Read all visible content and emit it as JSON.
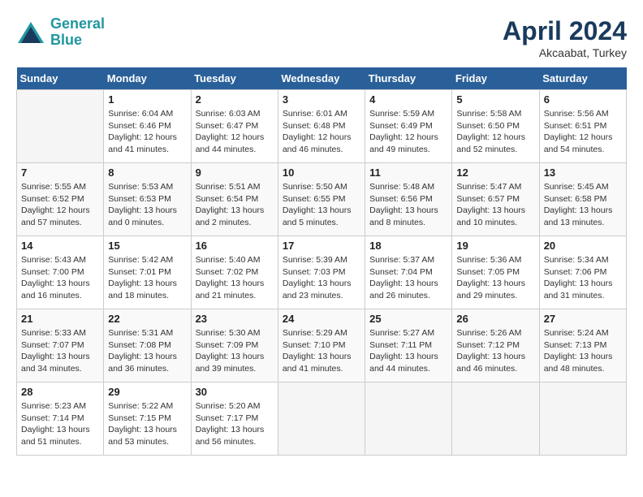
{
  "header": {
    "logo_line1": "General",
    "logo_line2": "Blue",
    "month_year": "April 2024",
    "location": "Akcaabat, Turkey"
  },
  "weekdays": [
    "Sunday",
    "Monday",
    "Tuesday",
    "Wednesday",
    "Thursday",
    "Friday",
    "Saturday"
  ],
  "weeks": [
    [
      {
        "day": "",
        "info": ""
      },
      {
        "day": "1",
        "info": "Sunrise: 6:04 AM\nSunset: 6:46 PM\nDaylight: 12 hours\nand 41 minutes."
      },
      {
        "day": "2",
        "info": "Sunrise: 6:03 AM\nSunset: 6:47 PM\nDaylight: 12 hours\nand 44 minutes."
      },
      {
        "day": "3",
        "info": "Sunrise: 6:01 AM\nSunset: 6:48 PM\nDaylight: 12 hours\nand 46 minutes."
      },
      {
        "day": "4",
        "info": "Sunrise: 5:59 AM\nSunset: 6:49 PM\nDaylight: 12 hours\nand 49 minutes."
      },
      {
        "day": "5",
        "info": "Sunrise: 5:58 AM\nSunset: 6:50 PM\nDaylight: 12 hours\nand 52 minutes."
      },
      {
        "day": "6",
        "info": "Sunrise: 5:56 AM\nSunset: 6:51 PM\nDaylight: 12 hours\nand 54 minutes."
      }
    ],
    [
      {
        "day": "7",
        "info": "Sunrise: 5:55 AM\nSunset: 6:52 PM\nDaylight: 12 hours\nand 57 minutes."
      },
      {
        "day": "8",
        "info": "Sunrise: 5:53 AM\nSunset: 6:53 PM\nDaylight: 13 hours\nand 0 minutes."
      },
      {
        "day": "9",
        "info": "Sunrise: 5:51 AM\nSunset: 6:54 PM\nDaylight: 13 hours\nand 2 minutes."
      },
      {
        "day": "10",
        "info": "Sunrise: 5:50 AM\nSunset: 6:55 PM\nDaylight: 13 hours\nand 5 minutes."
      },
      {
        "day": "11",
        "info": "Sunrise: 5:48 AM\nSunset: 6:56 PM\nDaylight: 13 hours\nand 8 minutes."
      },
      {
        "day": "12",
        "info": "Sunrise: 5:47 AM\nSunset: 6:57 PM\nDaylight: 13 hours\nand 10 minutes."
      },
      {
        "day": "13",
        "info": "Sunrise: 5:45 AM\nSunset: 6:58 PM\nDaylight: 13 hours\nand 13 minutes."
      }
    ],
    [
      {
        "day": "14",
        "info": "Sunrise: 5:43 AM\nSunset: 7:00 PM\nDaylight: 13 hours\nand 16 minutes."
      },
      {
        "day": "15",
        "info": "Sunrise: 5:42 AM\nSunset: 7:01 PM\nDaylight: 13 hours\nand 18 minutes."
      },
      {
        "day": "16",
        "info": "Sunrise: 5:40 AM\nSunset: 7:02 PM\nDaylight: 13 hours\nand 21 minutes."
      },
      {
        "day": "17",
        "info": "Sunrise: 5:39 AM\nSunset: 7:03 PM\nDaylight: 13 hours\nand 23 minutes."
      },
      {
        "day": "18",
        "info": "Sunrise: 5:37 AM\nSunset: 7:04 PM\nDaylight: 13 hours\nand 26 minutes."
      },
      {
        "day": "19",
        "info": "Sunrise: 5:36 AM\nSunset: 7:05 PM\nDaylight: 13 hours\nand 29 minutes."
      },
      {
        "day": "20",
        "info": "Sunrise: 5:34 AM\nSunset: 7:06 PM\nDaylight: 13 hours\nand 31 minutes."
      }
    ],
    [
      {
        "day": "21",
        "info": "Sunrise: 5:33 AM\nSunset: 7:07 PM\nDaylight: 13 hours\nand 34 minutes."
      },
      {
        "day": "22",
        "info": "Sunrise: 5:31 AM\nSunset: 7:08 PM\nDaylight: 13 hours\nand 36 minutes."
      },
      {
        "day": "23",
        "info": "Sunrise: 5:30 AM\nSunset: 7:09 PM\nDaylight: 13 hours\nand 39 minutes."
      },
      {
        "day": "24",
        "info": "Sunrise: 5:29 AM\nSunset: 7:10 PM\nDaylight: 13 hours\nand 41 minutes."
      },
      {
        "day": "25",
        "info": "Sunrise: 5:27 AM\nSunset: 7:11 PM\nDaylight: 13 hours\nand 44 minutes."
      },
      {
        "day": "26",
        "info": "Sunrise: 5:26 AM\nSunset: 7:12 PM\nDaylight: 13 hours\nand 46 minutes."
      },
      {
        "day": "27",
        "info": "Sunrise: 5:24 AM\nSunset: 7:13 PM\nDaylight: 13 hours\nand 48 minutes."
      }
    ],
    [
      {
        "day": "28",
        "info": "Sunrise: 5:23 AM\nSunset: 7:14 PM\nDaylight: 13 hours\nand 51 minutes."
      },
      {
        "day": "29",
        "info": "Sunrise: 5:22 AM\nSunset: 7:15 PM\nDaylight: 13 hours\nand 53 minutes."
      },
      {
        "day": "30",
        "info": "Sunrise: 5:20 AM\nSunset: 7:17 PM\nDaylight: 13 hours\nand 56 minutes."
      },
      {
        "day": "",
        "info": ""
      },
      {
        "day": "",
        "info": ""
      },
      {
        "day": "",
        "info": ""
      },
      {
        "day": "",
        "info": ""
      }
    ]
  ]
}
